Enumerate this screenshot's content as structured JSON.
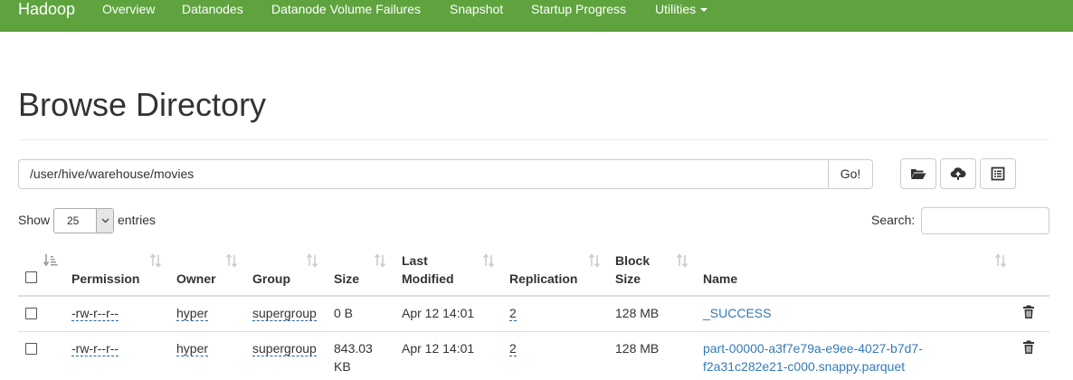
{
  "navbar": {
    "brand": "Hadoop",
    "items": [
      "Overview",
      "Datanodes",
      "Datanode Volume Failures",
      "Snapshot",
      "Startup Progress"
    ],
    "utilities": "Utilities",
    "bg_color": "#5fa33e"
  },
  "page": {
    "title": "Browse Directory"
  },
  "path_bar": {
    "value": "/user/hive/warehouse/movies",
    "go_label": "Go!"
  },
  "toolbar": {
    "icons": [
      "folder-open-icon",
      "cloud-upload-icon",
      "list-alt-icon"
    ]
  },
  "entries": {
    "show_label": "Show",
    "value": "25",
    "suffix": "entries"
  },
  "search": {
    "label": "Search:",
    "value": ""
  },
  "table": {
    "columns": [
      "Permission",
      "Owner",
      "Group",
      "Size",
      "Last",
      "Modified",
      "Replication",
      "Block",
      "Size",
      "Name"
    ],
    "rows": [
      {
        "permission": "-rw-r--r--",
        "owner": "hyper",
        "group": "supergroup",
        "size": [
          "0 B"
        ],
        "modified": "Apr 12 14:01",
        "replication": "2",
        "block_size": "128 MB",
        "name": [
          "_SUCCESS"
        ]
      },
      {
        "permission": "-rw-r--r--",
        "owner": "hyper",
        "group": "supergroup",
        "size": [
          "843.03",
          "KB"
        ],
        "modified": "Apr 12 14:01",
        "replication": "2",
        "block_size": "128 MB",
        "name": [
          "part-00000-a3f7e79a-e9ee-4027-b7d7-",
          "f2a31c282e21-c000.snappy.parquet"
        ]
      }
    ]
  }
}
